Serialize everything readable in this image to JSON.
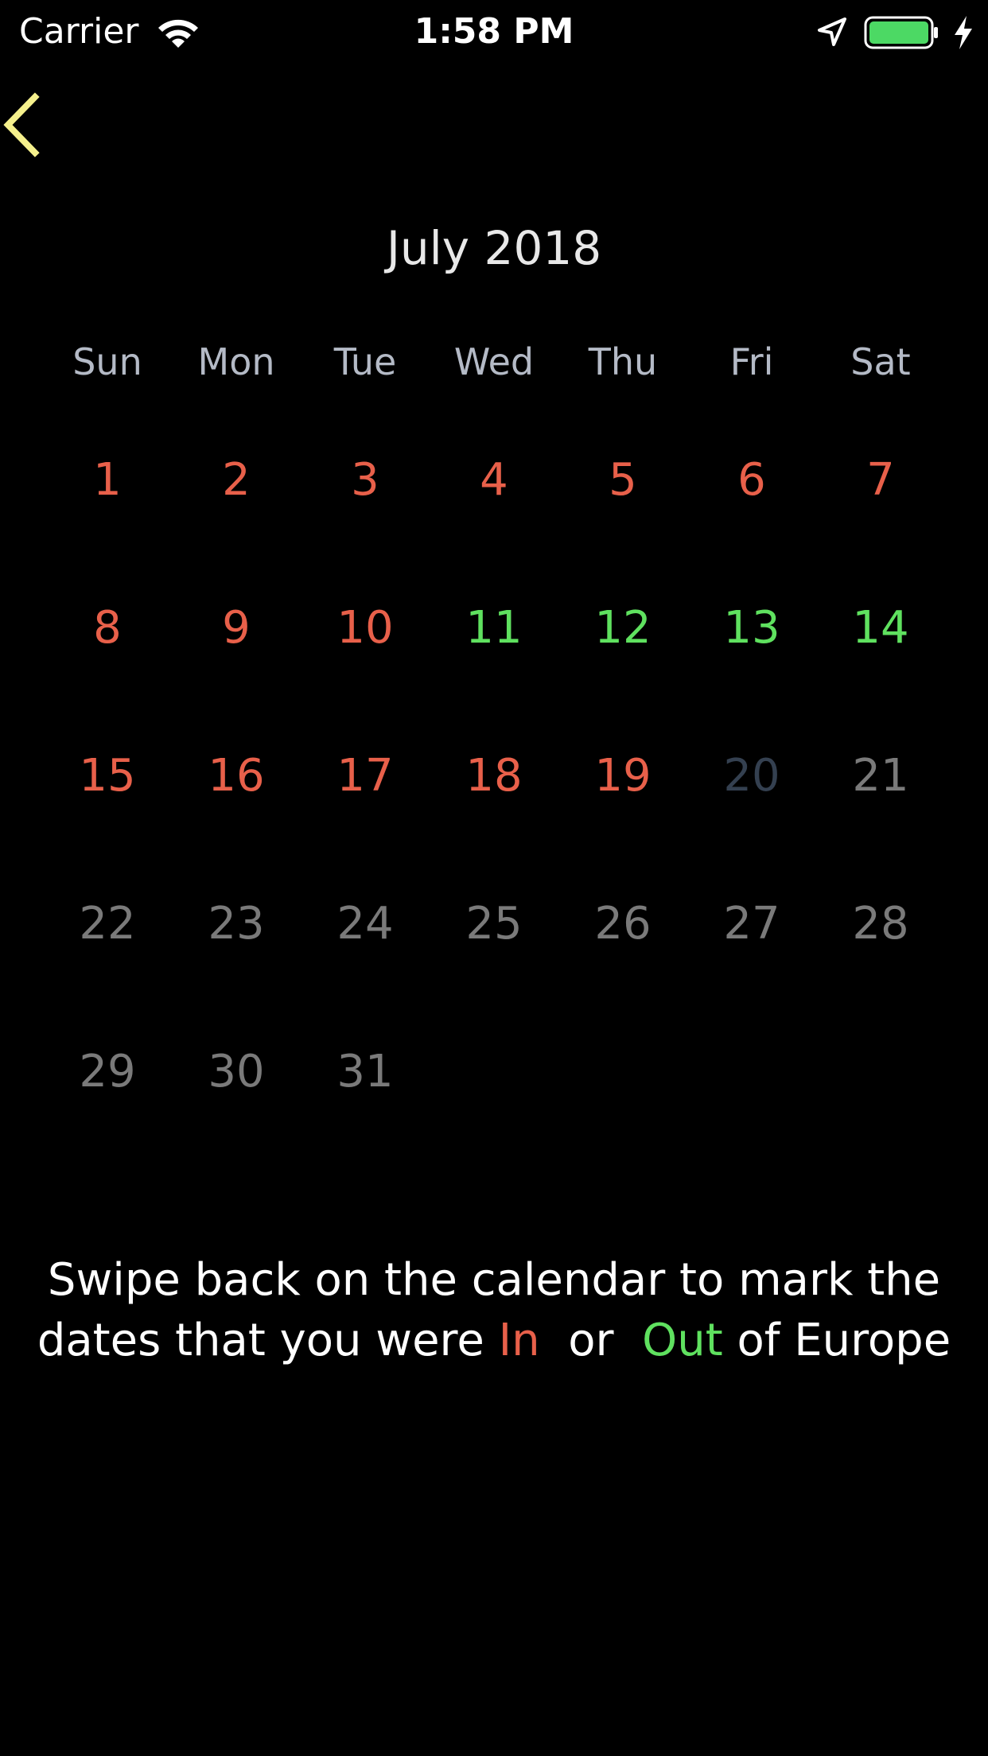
{
  "status_bar": {
    "carrier": "Carrier",
    "time": "1:58 PM",
    "icons": [
      "wifi-icon",
      "location-arrow-icon",
      "battery-icon",
      "charging-bolt-icon"
    ],
    "battery_color": "#4cd964"
  },
  "nav": {
    "back_icon": "chevron-left-icon",
    "back_color": "#f5f08c"
  },
  "calendar": {
    "month_title": "July 2018",
    "weekdays": [
      "Sun",
      "Mon",
      "Tue",
      "Wed",
      "Thu",
      "Fri",
      "Sat"
    ],
    "weeks": [
      [
        {
          "d": "1",
          "s": "in"
        },
        {
          "d": "2",
          "s": "in"
        },
        {
          "d": "3",
          "s": "in"
        },
        {
          "d": "4",
          "s": "in"
        },
        {
          "d": "5",
          "s": "in"
        },
        {
          "d": "6",
          "s": "in"
        },
        {
          "d": "7",
          "s": "in"
        }
      ],
      [
        {
          "d": "8",
          "s": "in"
        },
        {
          "d": "9",
          "s": "in"
        },
        {
          "d": "10",
          "s": "in"
        },
        {
          "d": "11",
          "s": "out"
        },
        {
          "d": "12",
          "s": "out"
        },
        {
          "d": "13",
          "s": "out"
        },
        {
          "d": "14",
          "s": "out"
        }
      ],
      [
        {
          "d": "15",
          "s": "in"
        },
        {
          "d": "16",
          "s": "in"
        },
        {
          "d": "17",
          "s": "in"
        },
        {
          "d": "18",
          "s": "in"
        },
        {
          "d": "19",
          "s": "in"
        },
        {
          "d": "20",
          "s": "today"
        },
        {
          "d": "21",
          "s": "future"
        }
      ],
      [
        {
          "d": "22",
          "s": "future"
        },
        {
          "d": "23",
          "s": "future"
        },
        {
          "d": "24",
          "s": "future"
        },
        {
          "d": "25",
          "s": "future"
        },
        {
          "d": "26",
          "s": "future"
        },
        {
          "d": "27",
          "s": "future"
        },
        {
          "d": "28",
          "s": "future"
        }
      ],
      [
        {
          "d": "29",
          "s": "future"
        },
        {
          "d": "30",
          "s": "future"
        },
        {
          "d": "31",
          "s": "future"
        },
        {
          "d": "",
          "s": "empty"
        },
        {
          "d": "",
          "s": "empty"
        },
        {
          "d": "",
          "s": "empty"
        },
        {
          "d": "",
          "s": "empty"
        }
      ]
    ],
    "colors": {
      "in": "#e8604a",
      "out": "#5fe15f",
      "today": "#344050",
      "future": "#7a7a7a"
    }
  },
  "instructions": {
    "line1": "Swipe back on the calendar to mark the",
    "line2_prefix": "dates that you were",
    "in_word": "In",
    "or_word": "or",
    "out_word": "Out",
    "line2_suffix": "of Europe"
  }
}
